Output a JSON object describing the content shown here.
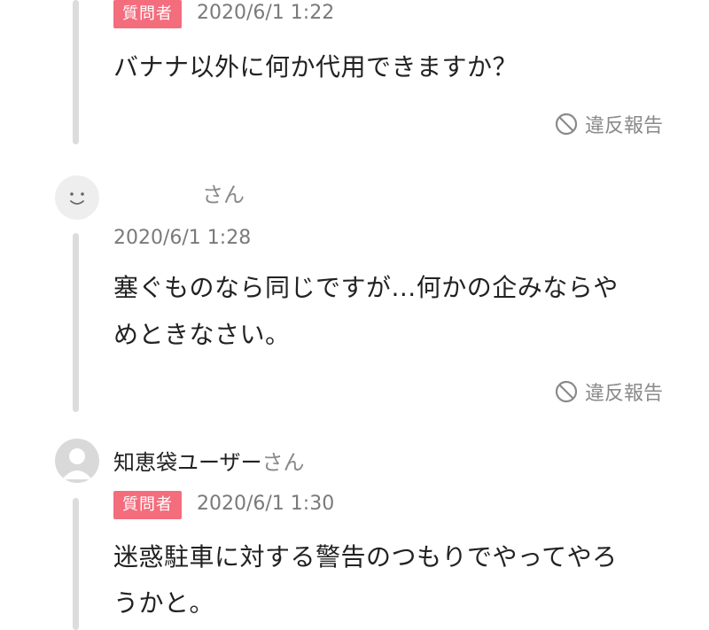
{
  "colors": {
    "badge": "#f36d7d",
    "timeline": "#dcdcdc",
    "muted": "#8a8a8a"
  },
  "items": [
    {
      "badge": "質問者",
      "date": "2020/6/1 1:22",
      "text": "バナナ以外に何か代用できますか？",
      "report": "違反報告",
      "report_icon": "prohibited-icon"
    },
    {
      "avatar_icon": "smiley-face-icon",
      "username": "",
      "san": "さん",
      "date": "2020/6/1 1:28",
      "text_line1": "塞ぐものなら同じですが...何かの企みならや",
      "text_line2": "めときなさい。",
      "report": "違反報告",
      "report_icon": "prohibited-icon"
    },
    {
      "avatar_icon": "user-silhouette-icon",
      "username": "知恵袋ユーザー",
      "san": "さん",
      "badge": "質問者",
      "date": "2020/6/1 1:30",
      "text_line1": "迷惑駐車に対する警告のつもりでやってやろ",
      "text_line2": "うかと。"
    }
  ]
}
